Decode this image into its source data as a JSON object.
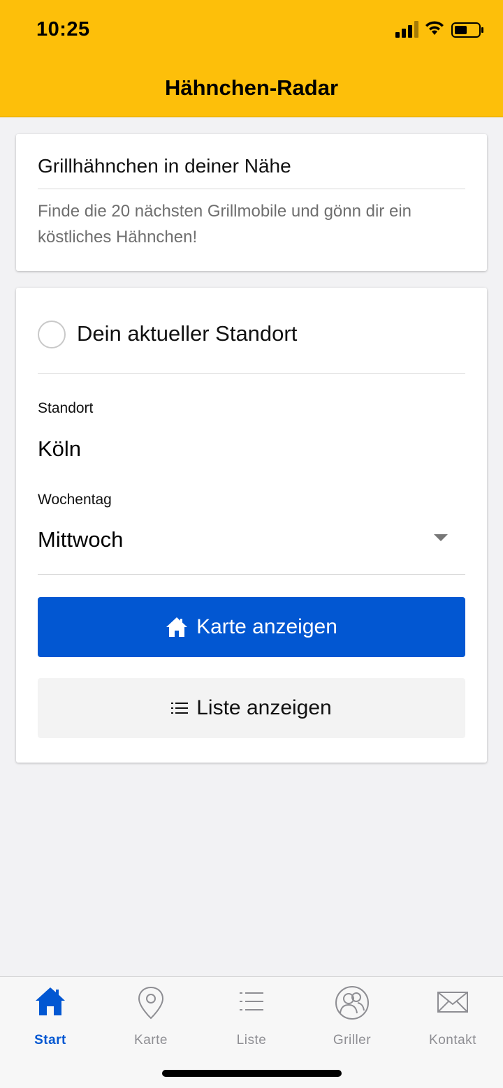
{
  "status_bar": {
    "time": "10:25"
  },
  "header": {
    "title": "Hähnchen-Radar"
  },
  "intro_card": {
    "title": "Grillhähnchen in deiner Nähe",
    "text": "Finde die 20 nächsten Grillmobile und gönn dir ein köstliches Hähnchen!"
  },
  "form": {
    "current_location_label": "Dein aktueller Standort",
    "current_location_checked": false,
    "location_label": "Standort",
    "location_value": "Köln",
    "weekday_label": "Wochentag",
    "weekday_value": "Mittwoch",
    "map_button_label": "Karte anzeigen",
    "list_button_label": "Liste anzeigen"
  },
  "tabbar": {
    "tabs": [
      {
        "label": "Start",
        "icon": "home-icon",
        "active": true
      },
      {
        "label": "Karte",
        "icon": "map-pin-icon",
        "active": false
      },
      {
        "label": "Liste",
        "icon": "list-icon",
        "active": false
      },
      {
        "label": "Griller",
        "icon": "people-icon",
        "active": false
      },
      {
        "label": "Kontakt",
        "icon": "mail-icon",
        "active": false
      }
    ]
  },
  "colors": {
    "header_bg": "#fdbf0a",
    "primary": "#0257d2",
    "background": "#f2f2f4",
    "inactive_tab": "#8e8e93"
  }
}
